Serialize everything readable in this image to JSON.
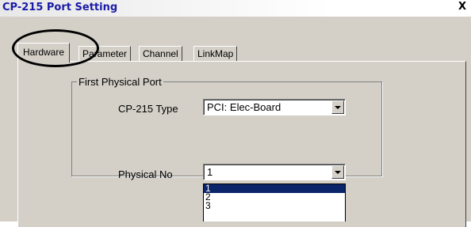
{
  "window": {
    "title": "CP-215 Port Setting",
    "close_label": "X"
  },
  "tabs": [
    {
      "label": "Hardware",
      "active": true
    },
    {
      "label": "Parameter",
      "active": false
    },
    {
      "label": "Channel",
      "active": false
    },
    {
      "label": "LinkMap",
      "active": false
    }
  ],
  "hardware": {
    "type_label": "CP-215 Type",
    "type_value": "PCI: Elec-Board",
    "group_title": "First Physical Port",
    "physical_no_label": "Physical No",
    "physical_no_value": "1",
    "physical_no_options": [
      "1",
      "2",
      "3"
    ],
    "physical_no_selected": "1"
  },
  "colors": {
    "title_text": "#1a1aa8",
    "selection": "#0a246a",
    "annotation_circle": "#000000"
  }
}
